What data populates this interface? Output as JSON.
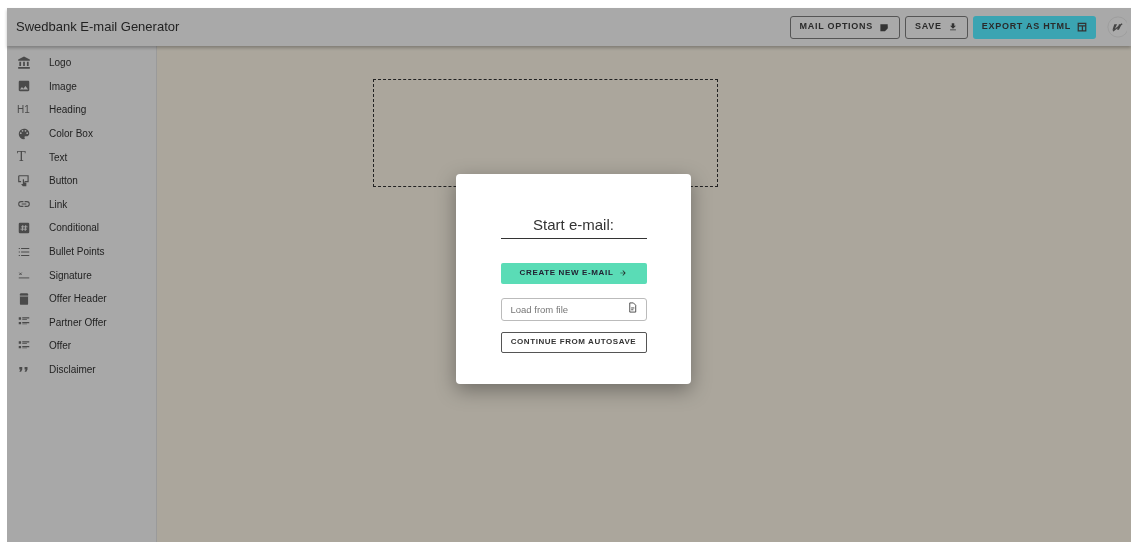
{
  "app_title": "Swedbank E-mail Generator",
  "toolbar": [
    {
      "label": "MAIL OPTIONS",
      "kind": "outlined"
    },
    {
      "label": "SAVE",
      "kind": "outlined"
    },
    {
      "label": "EXPORT AS HTML",
      "kind": "filled"
    }
  ],
  "sidebar": {
    "items": [
      {
        "label": "Logo"
      },
      {
        "label": "Image"
      },
      {
        "label": "Heading",
        "icon_text": "H1"
      },
      {
        "label": "Color Box"
      },
      {
        "label": "Text",
        "icon_text": "T"
      },
      {
        "label": "Button"
      },
      {
        "label": "Link"
      },
      {
        "label": "Conditional"
      },
      {
        "label": "Bullet Points"
      },
      {
        "label": "Signature"
      },
      {
        "label": "Offer Header"
      },
      {
        "label": "Partner Offer"
      },
      {
        "label": "Offer"
      },
      {
        "label": "Disclaimer"
      }
    ]
  },
  "dialog": {
    "title": "Start e-mail:",
    "primary_button": "CREATE NEW E-MAIL",
    "file_field": {
      "placeholder": "Load from file"
    },
    "secondary_button": "CONTINUE FROM AUTOSAVE"
  }
}
